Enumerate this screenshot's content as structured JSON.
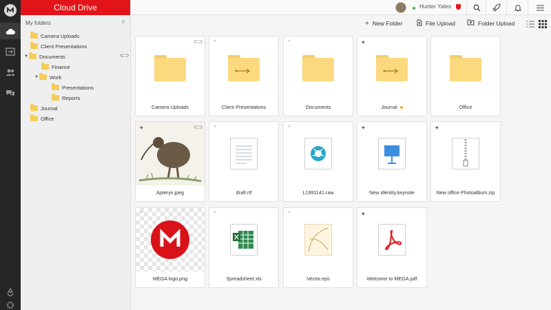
{
  "sidebar": {
    "title": "Cloud Drive",
    "tree_header": "My folders",
    "tree_header_badge": "0",
    "items": [
      {
        "label": "Camera Uploads"
      },
      {
        "label": "Client Presentations"
      },
      {
        "label": "Documents"
      },
      {
        "label": "Finance"
      },
      {
        "label": "Work"
      },
      {
        "label": "Presentations"
      },
      {
        "label": "Reports"
      },
      {
        "label": "Journal"
      },
      {
        "label": "Office"
      }
    ],
    "rail_icons": [
      "mega-logo-icon",
      "cloud-drive-icon",
      "transfers-icon",
      "contacts-icon",
      "chat-icon",
      "rubbish-bin-icon",
      "settings-icon"
    ]
  },
  "header": {
    "user_name": "Hunter Yates"
  },
  "toolbar": {
    "new_folder": "New Folder",
    "file_upload": "File Upload",
    "folder_upload": "Folder Upload"
  },
  "files": [
    {
      "name": "Camera Uploads",
      "kind": "folder"
    },
    {
      "name": "Client Presentations",
      "kind": "shared-folder"
    },
    {
      "name": "Documents",
      "kind": "folder"
    },
    {
      "name": "Journal",
      "kind": "shared-folder",
      "favorite": true
    },
    {
      "name": "Office",
      "kind": "folder"
    },
    {
      "name": "Apteryx.jpeg",
      "kind": "image",
      "favorite": true
    },
    {
      "name": "draft.rtf",
      "kind": "text"
    },
    {
      "name": "L1991141.raw",
      "kind": "raw"
    },
    {
      "name": "New identity.keynote",
      "kind": "keynote",
      "favorite": true
    },
    {
      "name": "New office Photoalbum.zip",
      "kind": "zip",
      "favorite": true
    },
    {
      "name": "MEGA logo.png",
      "kind": "png"
    },
    {
      "name": "Spreadsheet.xls",
      "kind": "xls"
    },
    {
      "name": "Vector.eps",
      "kind": "eps"
    },
    {
      "name": "Welcome to MEGA.pdf",
      "kind": "pdf",
      "favorite": true
    }
  ],
  "colors": {
    "brand": "#e3131a",
    "folder": "#fbd97f",
    "rail": "#262626"
  }
}
